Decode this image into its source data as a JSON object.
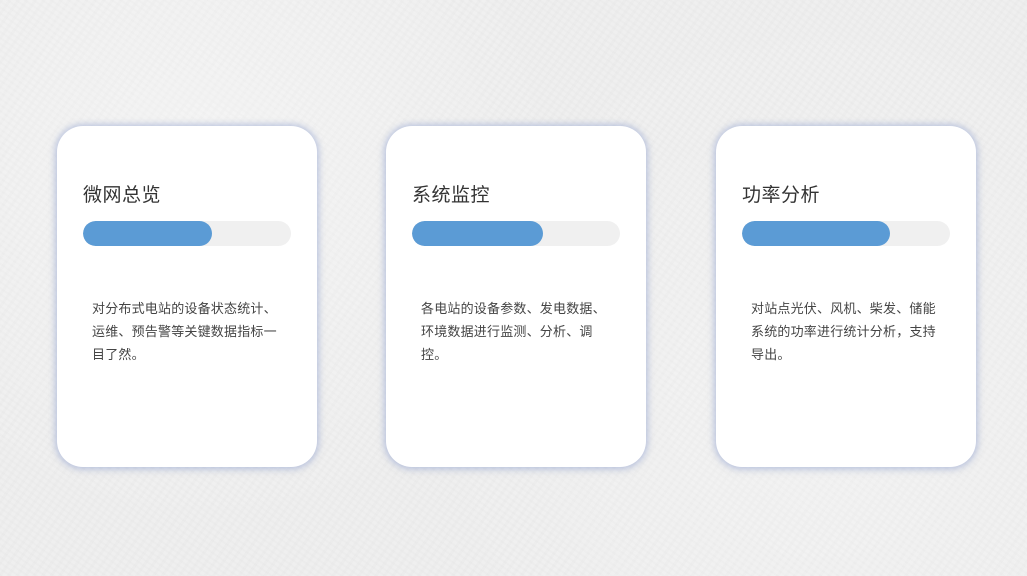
{
  "cards": [
    {
      "title": "微网总览",
      "progress": 0.62,
      "description": "对分布式电站的设备状态统计、运维、预告警等关键数据指标一目了然。"
    },
    {
      "title": "系统监控",
      "progress": 0.63,
      "description": "各电站的设备参数、发电数据、环境数据进行监测、分析、调控。"
    },
    {
      "title": "功率分析",
      "progress": 0.71,
      "description": "对站点光伏、风机、柴发、储能系统的功率进行统计分析，支持导出。"
    }
  ],
  "colors": {
    "progress_fill": "#5b9bd5",
    "progress_track": "#f0f0f0",
    "card_background": "#ffffff",
    "page_background": "#efefef"
  }
}
